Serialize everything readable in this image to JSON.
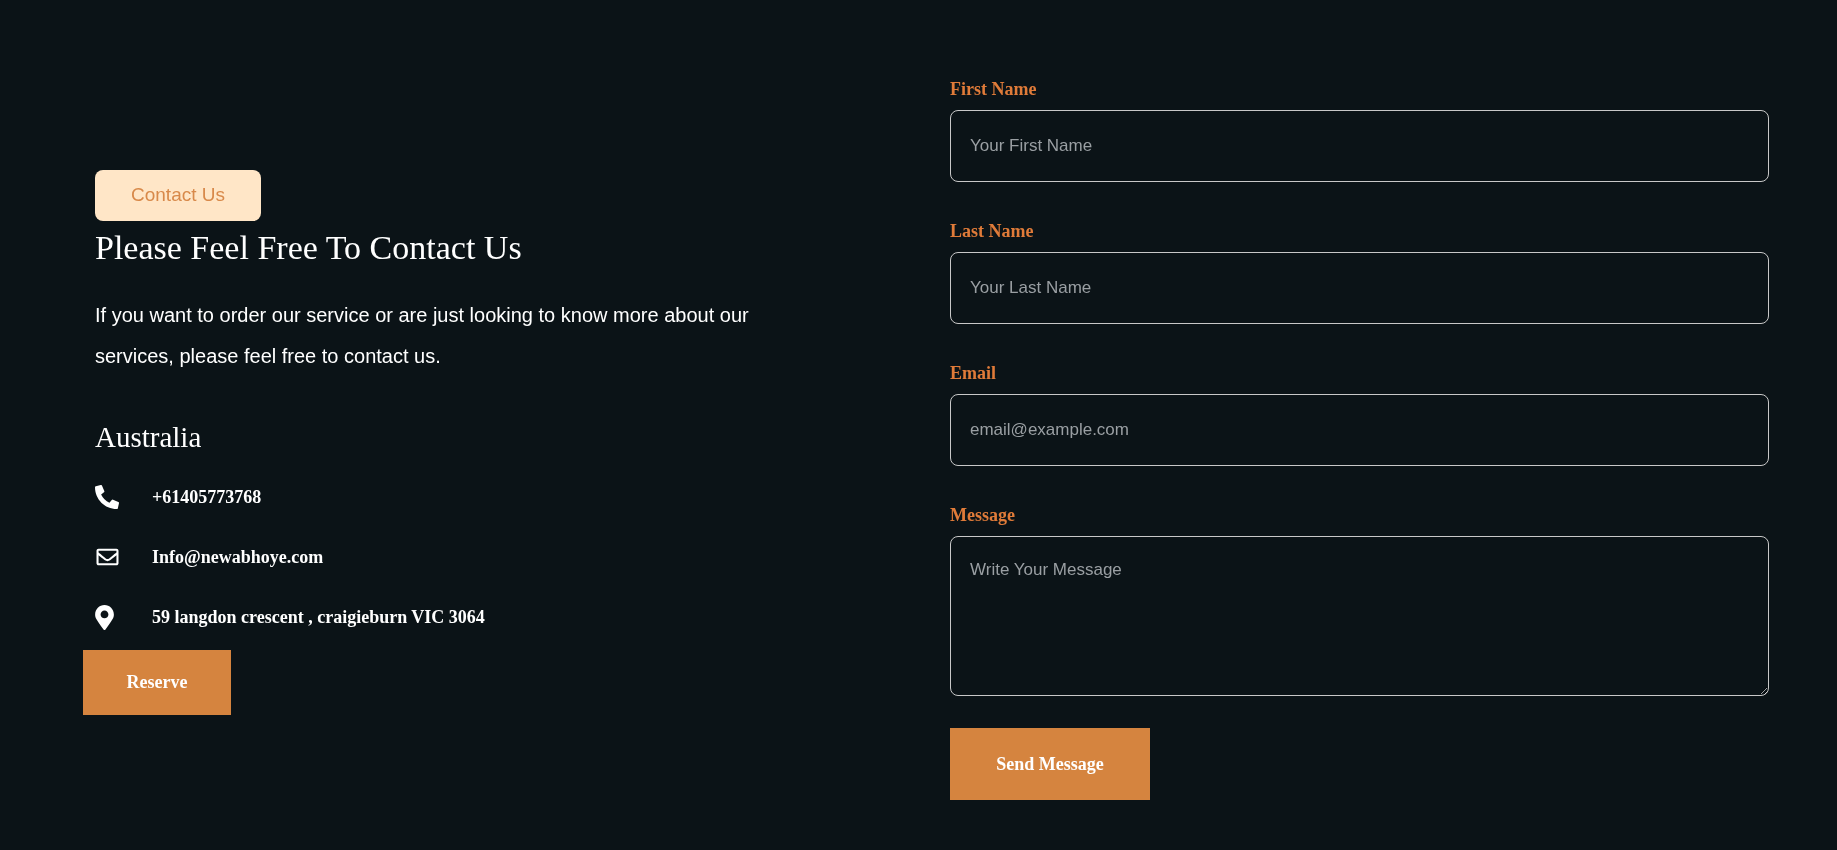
{
  "contact_badge": "Contact Us",
  "heading": "Please Feel Free To Contact Us",
  "intro": "If you want to order our service or are just looking to know more about our services, please feel free to contact us.",
  "region": "Australia",
  "contacts": [
    {
      "kind": "phone",
      "text": "+61405773768"
    },
    {
      "kind": "email",
      "text": "Info@newabhoye.com"
    },
    {
      "kind": "location",
      "text": "59 langdon crescent , craigieburn VIC 3064"
    }
  ],
  "reserve_button": "Reserve",
  "form": {
    "fields": [
      {
        "kind": "input",
        "label": "First Name",
        "placeholder": "Your First Name"
      },
      {
        "kind": "input",
        "label": "Last Name",
        "placeholder": "Your Last Name"
      },
      {
        "kind": "input",
        "label": "Email",
        "placeholder": "email@example.com"
      },
      {
        "kind": "textarea",
        "label": "Message",
        "placeholder": "Write Your Message"
      }
    ],
    "submit": "Send Message"
  }
}
